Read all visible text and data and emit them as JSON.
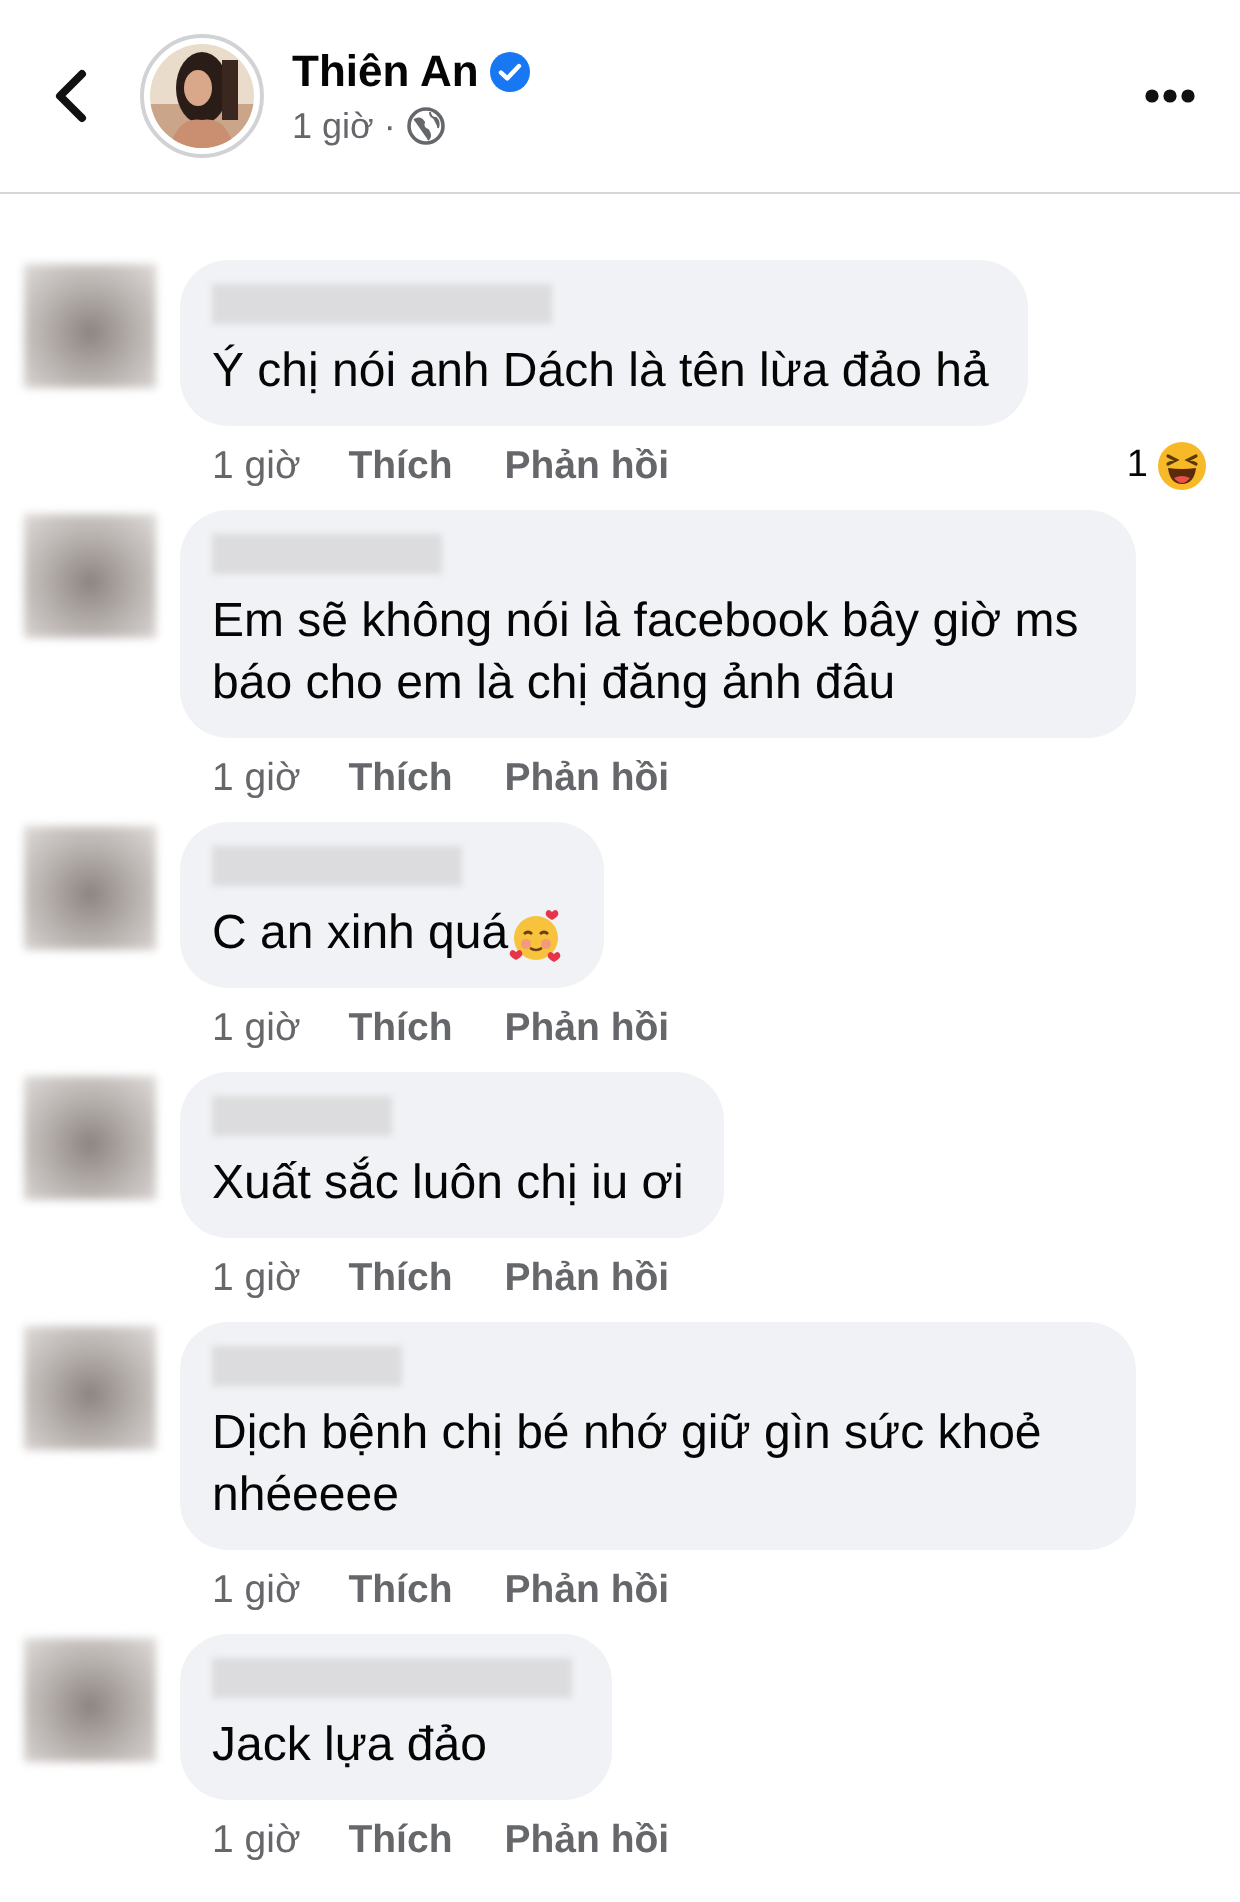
{
  "header": {
    "name": "Thiên An",
    "verified": true,
    "time": "1 giờ",
    "separator": "·"
  },
  "comments": [
    {
      "text": "Ý chị nói anh Dách là tên lừa đảo hả",
      "time": "1 giờ",
      "like": "Thích",
      "reply": "Phản hồi",
      "reaction": {
        "count": "1",
        "kind": "haha"
      }
    },
    {
      "text": "Em sẽ không nói là facebook bây giờ ms báo cho em là chị đăng ảnh đâu",
      "time": "1 giờ",
      "like": "Thích",
      "reply": "Phản hồi"
    },
    {
      "text": "C an xinh quá",
      "trailing_emoji": {
        "kind": "smiling-hearts"
      },
      "time": "1 giờ",
      "like": "Thích",
      "reply": "Phản hồi"
    },
    {
      "text": "Xuất sắc luôn chị iu ơi",
      "time": "1 giờ",
      "like": "Thích",
      "reply": "Phản hồi"
    },
    {
      "text": "Dịch bệnh chị bé nhớ giữ gìn sức khoẻ nhéeeee",
      "time": "1 giờ",
      "like": "Thích",
      "reply": "Phản hồi"
    },
    {
      "text": "Jack lựa đảo",
      "time": "1 giờ",
      "like": "Thích",
      "reply": "Phản hồi"
    }
  ]
}
